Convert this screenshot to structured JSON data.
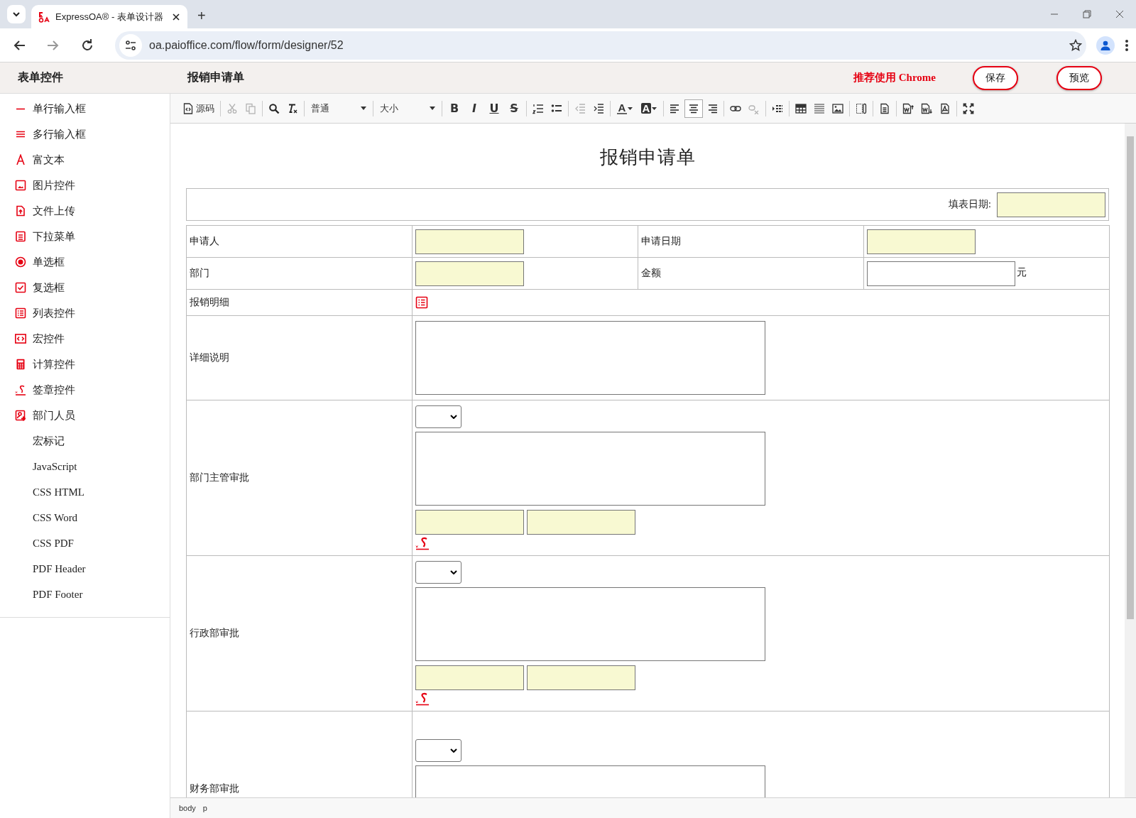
{
  "browser": {
    "tabs": [
      {
        "title": "ExpressOA® - 表单设计器",
        "selected": true
      }
    ],
    "new_tab": "+",
    "url": "oa.paioffice.com/flow/form/designer/52"
  },
  "header": {
    "sidebar_title": "表单控件",
    "form_name": "报销申请单",
    "notice": "推荐使用 Chrome",
    "buttons": [
      "保存",
      "预览"
    ]
  },
  "sidebar": {
    "items": [
      {
        "label": "单行输入框",
        "kind": "control"
      },
      {
        "label": "多行输入框",
        "kind": "control"
      },
      {
        "label": "富文本",
        "kind": "control"
      },
      {
        "label": "图片控件",
        "kind": "control"
      },
      {
        "label": "文件上传",
        "kind": "control"
      },
      {
        "label": "下拉菜单",
        "kind": "control"
      },
      {
        "label": "单选框",
        "kind": "control"
      },
      {
        "label": "复选框",
        "kind": "control"
      },
      {
        "label": "列表控件",
        "kind": "control"
      },
      {
        "label": "宏控件",
        "kind": "control"
      },
      {
        "label": "计算控件",
        "kind": "control"
      },
      {
        "label": "签章控件",
        "kind": "control"
      },
      {
        "label": "部门人员",
        "kind": "control"
      },
      {
        "label": "宏标记",
        "kind": "setting"
      },
      {
        "label": "JavaScript",
        "kind": "setting"
      },
      {
        "label": "CSS HTML",
        "kind": "setting"
      },
      {
        "label": "CSS Word",
        "kind": "setting"
      },
      {
        "label": "CSS PDF",
        "kind": "setting"
      },
      {
        "label": "PDF Header",
        "kind": "setting"
      },
      {
        "label": "PDF Footer",
        "kind": "setting"
      }
    ]
  },
  "toolbar": [
    [
      {
        "kind": "source",
        "label": "源码"
      }
    ],
    [
      {
        "kind": "icon",
        "disabled": true
      },
      {
        "kind": "icon",
        "disabled": true
      }
    ],
    [
      {
        "kind": "icon",
        "disabled": false
      },
      {
        "kind": "icon",
        "disabled": false
      }
    ],
    [
      {
        "kind": "dropdown",
        "label": "普通"
      }
    ],
    [
      {
        "kind": "dropdown",
        "label": "大小"
      }
    ],
    [
      {
        "kind": "bold",
        "label": "B"
      },
      {
        "kind": "italic",
        "label": "I"
      },
      {
        "kind": "underline",
        "label": "U"
      },
      {
        "kind": "strike",
        "label": "S"
      }
    ],
    [
      {
        "kind": "icon",
        "disabled": false
      },
      {
        "kind": "icon",
        "disabled": false
      }
    ],
    [
      {
        "kind": "icon",
        "disabled": true
      },
      {
        "kind": "icon",
        "disabled": false
      }
    ],
    [
      {
        "kind": "forecolor",
        "label": "A"
      },
      {
        "kind": "backcolor",
        "label": "A"
      }
    ],
    [
      {
        "kind": "icon",
        "disabled": false,
        "selected": false
      },
      {
        "kind": "icon",
        "disabled": false,
        "selected": true
      },
      {
        "kind": "icon",
        "disabled": false,
        "selected": false
      }
    ],
    [
      {
        "kind": "icon",
        "disabled": false
      },
      {
        "kind": "icon",
        "disabled": true
      }
    ],
    [
      {
        "kind": "icon",
        "disabled": false
      }
    ],
    [
      {
        "kind": "icon",
        "disabled": false
      },
      {
        "kind": "icon",
        "disabled": false
      },
      {
        "kind": "icon",
        "disabled": false
      }
    ],
    [
      {
        "kind": "icon",
        "disabled": false
      }
    ],
    [
      {
        "kind": "icon",
        "disabled": false
      }
    ],
    [
      {
        "kind": "icon",
        "disabled": false
      },
      {
        "kind": "icon",
        "disabled": false
      },
      {
        "kind": "icon",
        "disabled": false
      }
    ],
    [
      {
        "kind": "icon",
        "disabled": false
      }
    ]
  ],
  "form": {
    "title": "报销申请单",
    "date_label": "填表日期:",
    "date_field": {
      "highlight": true
    },
    "rows": [
      {
        "kind": "pair",
        "cells": [
          {
            "label": "申请人",
            "field": {
              "highlight": true
            }
          },
          {
            "label": "申请日期",
            "field": {
              "highlight": true
            }
          }
        ]
      },
      {
        "kind": "pair",
        "cells": [
          {
            "label": "部门",
            "field": {
              "highlight": true
            }
          },
          {
            "label": "金额",
            "field": {
              "highlight": false
            },
            "unit": "元"
          }
        ]
      },
      {
        "kind": "list",
        "label": "报销明细"
      },
      {
        "kind": "textarea",
        "label": "详细说明"
      },
      {
        "kind": "approval",
        "label": "部门主管审批",
        "fields": [
          {
            "highlight": true
          },
          {
            "highlight": true
          }
        ]
      },
      {
        "kind": "approval",
        "label": "行政部审批",
        "fields": [
          {
            "highlight": true
          },
          {
            "highlight": true
          }
        ]
      },
      {
        "kind": "approval",
        "label": "财务部审批"
      }
    ]
  },
  "status_bar": [
    "body",
    "p"
  ]
}
